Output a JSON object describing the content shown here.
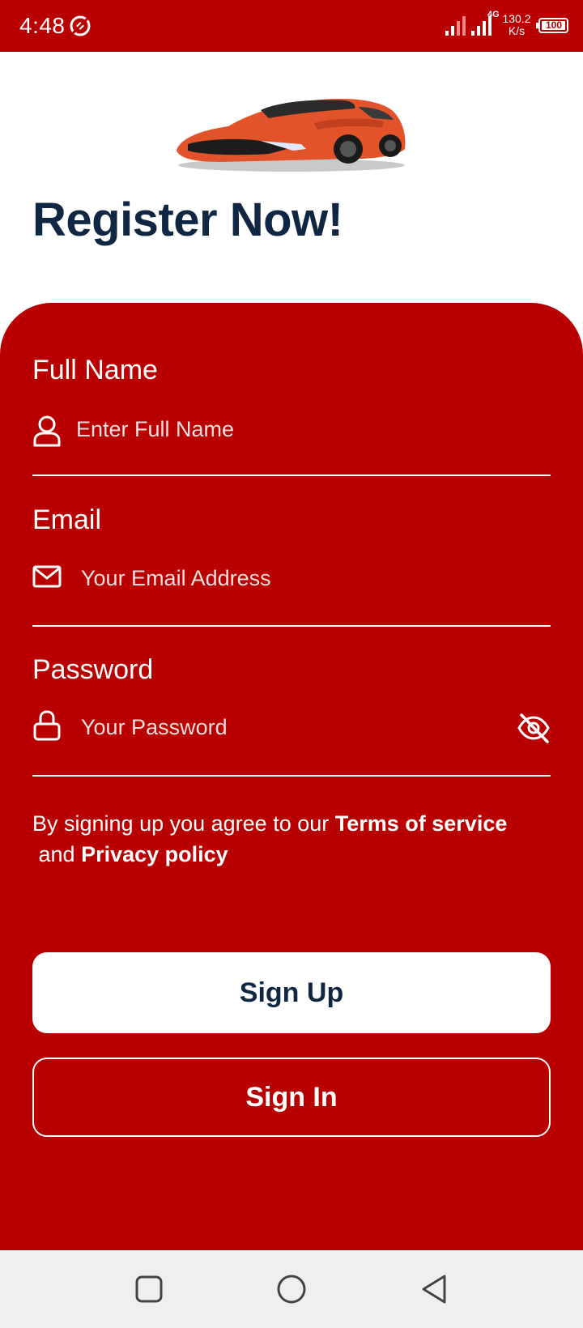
{
  "status_bar": {
    "time": "4:48",
    "network_type": "4G",
    "speed_value": "130.2",
    "speed_unit": "K/s",
    "battery": "100"
  },
  "header": {
    "title": "Register Now!",
    "image": "sports-car"
  },
  "form": {
    "full_name": {
      "label": "Full Name",
      "placeholder": "Enter Full Name",
      "icon": "user-icon"
    },
    "email": {
      "label": "Email",
      "placeholder": "Your Email Address",
      "icon": "mail-icon"
    },
    "password": {
      "label": "Password",
      "placeholder": "Your Password",
      "icon": "lock-icon",
      "toggle_icon": "eye-off-icon"
    }
  },
  "terms": {
    "prefix": "By signing up you agree to our ",
    "terms_link": "Terms of service",
    "middle": " and ",
    "privacy_link": "Privacy policy"
  },
  "buttons": {
    "sign_up": "Sign Up",
    "sign_in": "Sign In"
  },
  "colors": {
    "primary": "#b80000",
    "title": "#0f2743",
    "white": "#ffffff"
  }
}
